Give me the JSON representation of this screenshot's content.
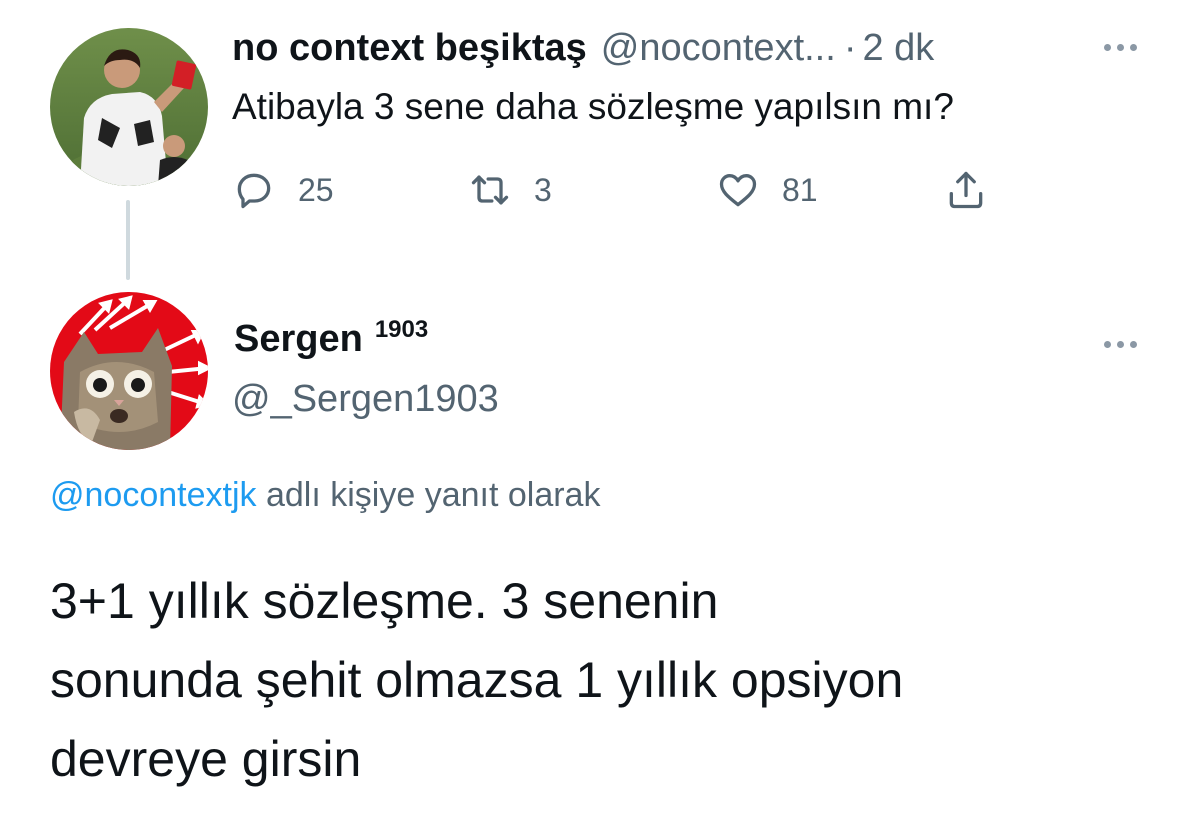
{
  "parent_tweet": {
    "display_name": "no context beşiktaş",
    "handle": "@nocontext...",
    "separator": "·",
    "time": "2 dk",
    "text": "Atibayla 3 sene daha sözleşme yapılsın mı?",
    "avatar": "profile-photo-football-player-red-card",
    "actions": {
      "reply_count": "25",
      "retweet_count": "3",
      "like_count": "81"
    }
  },
  "reply_tweet": {
    "display_name": "Sergen",
    "name_suffix": "1903",
    "handle": "@_Sergen1903",
    "avatar": "profile-photo-cat-with-red-flag",
    "reply_to": {
      "mention": "@nocontextjk",
      "label": "adlı kişiye yanıt olarak"
    },
    "body_lines": [
      "3+1 yıllık sözleşme. 3 senenin",
      "sonunda şehit olmazsa 1 yıllık opsiyon",
      "devreye girsin"
    ]
  },
  "colors": {
    "text": "#0f1419",
    "muted": "#536471",
    "link": "#1d9bf0",
    "thread_line": "#cfd9de"
  },
  "icons": [
    "reply-icon",
    "retweet-icon",
    "like-icon",
    "share-icon",
    "more-icon"
  ]
}
